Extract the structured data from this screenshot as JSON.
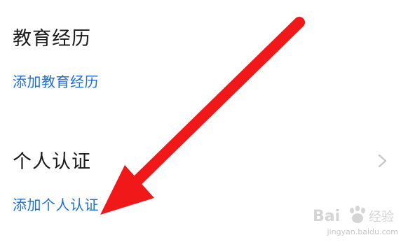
{
  "education": {
    "title": "教育经历",
    "add_link": "添加教育经历"
  },
  "certification": {
    "title": "个人认证",
    "add_link": "添加个人认证"
  },
  "icons": {
    "chevron": "chevron-right-icon",
    "annotation": "red-arrow"
  },
  "watermark": {
    "logo": "Bai 经验",
    "url": "jingyan.baidu.com"
  },
  "colors": {
    "link": "#1d6fd6",
    "title": "#1a1a1a",
    "arrow": "#f01818",
    "chevron": "#c8c8c8"
  }
}
